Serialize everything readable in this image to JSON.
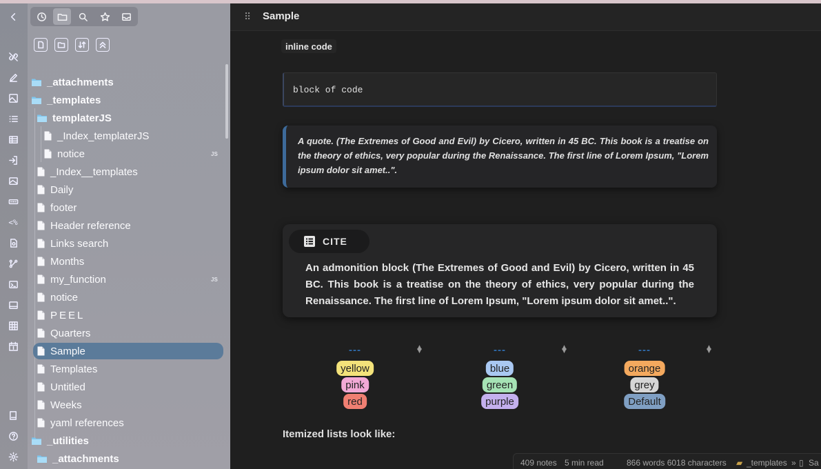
{
  "window": {
    "tab_title": "Sample"
  },
  "ribbon": {
    "icons": [
      "chevron-left-icon",
      "unlink-icon",
      "pencil-icon",
      "image-icon",
      "list-icon",
      "table-icon",
      "import-icon",
      "image-icon",
      "keyboard-icon",
      "template-icon",
      "file-search-icon",
      "graph-icon",
      "terminal-icon",
      "image-icon",
      "grid-icon",
      "calendar-icon",
      "book-icon",
      "help-icon",
      "settings-icon"
    ],
    "template_text": "<%"
  },
  "sidebar": {
    "tabs": [
      "clock-icon",
      "folder-icon",
      "search-icon",
      "star-icon",
      "inbox-icon"
    ],
    "actions": [
      "new-note-icon",
      "new-folder-icon",
      "sort-icon",
      "collapse-all-icon"
    ],
    "tree": [
      {
        "label": "_attachments",
        "type": "folder",
        "depth": 0
      },
      {
        "label": "_templates",
        "type": "folder",
        "depth": 0
      },
      {
        "label": "templaterJS",
        "type": "folder",
        "depth": 1
      },
      {
        "label": "_Index_templaterJS",
        "type": "file",
        "depth": 2
      },
      {
        "label": "notice",
        "type": "file",
        "depth": 2,
        "badge": "JS"
      },
      {
        "label": "_Index__templates",
        "type": "file",
        "depth": 1
      },
      {
        "label": "Daily",
        "type": "file",
        "depth": 1
      },
      {
        "label": "footer",
        "type": "file",
        "depth": 1
      },
      {
        "label": "Header reference",
        "type": "file",
        "depth": 1
      },
      {
        "label": "Links search",
        "type": "file",
        "depth": 1
      },
      {
        "label": "Months",
        "type": "file",
        "depth": 1
      },
      {
        "label": "my_function",
        "type": "file",
        "depth": 1,
        "badge": "JS"
      },
      {
        "label": "notice",
        "type": "file",
        "depth": 1
      },
      {
        "label": "PEEL",
        "type": "file",
        "depth": 1
      },
      {
        "label": "Quarters",
        "type": "file",
        "depth": 1
      },
      {
        "label": "Sample",
        "type": "file",
        "depth": 1,
        "selected": true
      },
      {
        "label": "Templates",
        "type": "file",
        "depth": 1
      },
      {
        "label": "Untitled",
        "type": "file",
        "depth": 1
      },
      {
        "label": "Weeks",
        "type": "file",
        "depth": 1
      },
      {
        "label": "yaml references",
        "type": "file",
        "depth": 1
      },
      {
        "label": "_utilities",
        "type": "folder",
        "depth": 0
      },
      {
        "label": "_attachments",
        "type": "folder",
        "depth": 1
      }
    ]
  },
  "content": {
    "inline_code": "inline code",
    "code_block": "block of code",
    "quote": "A quote. (The Extremes of Good and Evil) by Cicero, written in 45 BC. This book is a treatise on the theory of ethics, very popular during the Renaissance. The first line of Lorem Ipsum, \"Lorem ipsum dolor sit amet..\".",
    "admonition": {
      "title": "CITE",
      "body": "An admonition block (The Extremes of Good and Evil) by Cicero, written in 45 BC. This book is a treatise on the theory of ethics, very popular during the Renaissance. The first line of Lorem Ipsum, \"Lorem ipsum dolor sit amet..\"."
    },
    "tag_columns": [
      {
        "header": "---",
        "tags": [
          {
            "text": "yellow",
            "color": "#f3e27a"
          },
          {
            "text": "pink",
            "color": "#f2a9d6"
          },
          {
            "text": "red",
            "color": "#f07f72"
          }
        ]
      },
      {
        "header": "---",
        "tags": [
          {
            "text": "blue",
            "color": "#a9c8f2"
          },
          {
            "text": "green",
            "color": "#a6e3b5"
          },
          {
            "text": "purple",
            "color": "#c4b0ee"
          }
        ]
      },
      {
        "header": "---",
        "tags": [
          {
            "text": "orange",
            "color": "#f4a95e"
          },
          {
            "text": "grey",
            "color": "#d6d6d6"
          },
          {
            "text": "Default",
            "color": "#7f9fc3"
          }
        ]
      }
    ],
    "list_heading": "Itemized lists look like:"
  },
  "statusbar": {
    "notes": "409 notes",
    "read_time": "5 min read",
    "counts": "866 words 6018 characters",
    "breadcrumb_folder": "_templates",
    "breadcrumb_sep": "»",
    "breadcrumb_file": "Sa"
  },
  "colors": {
    "accent": "#2f6db0",
    "selected_bg": "#5b7b9a"
  }
}
